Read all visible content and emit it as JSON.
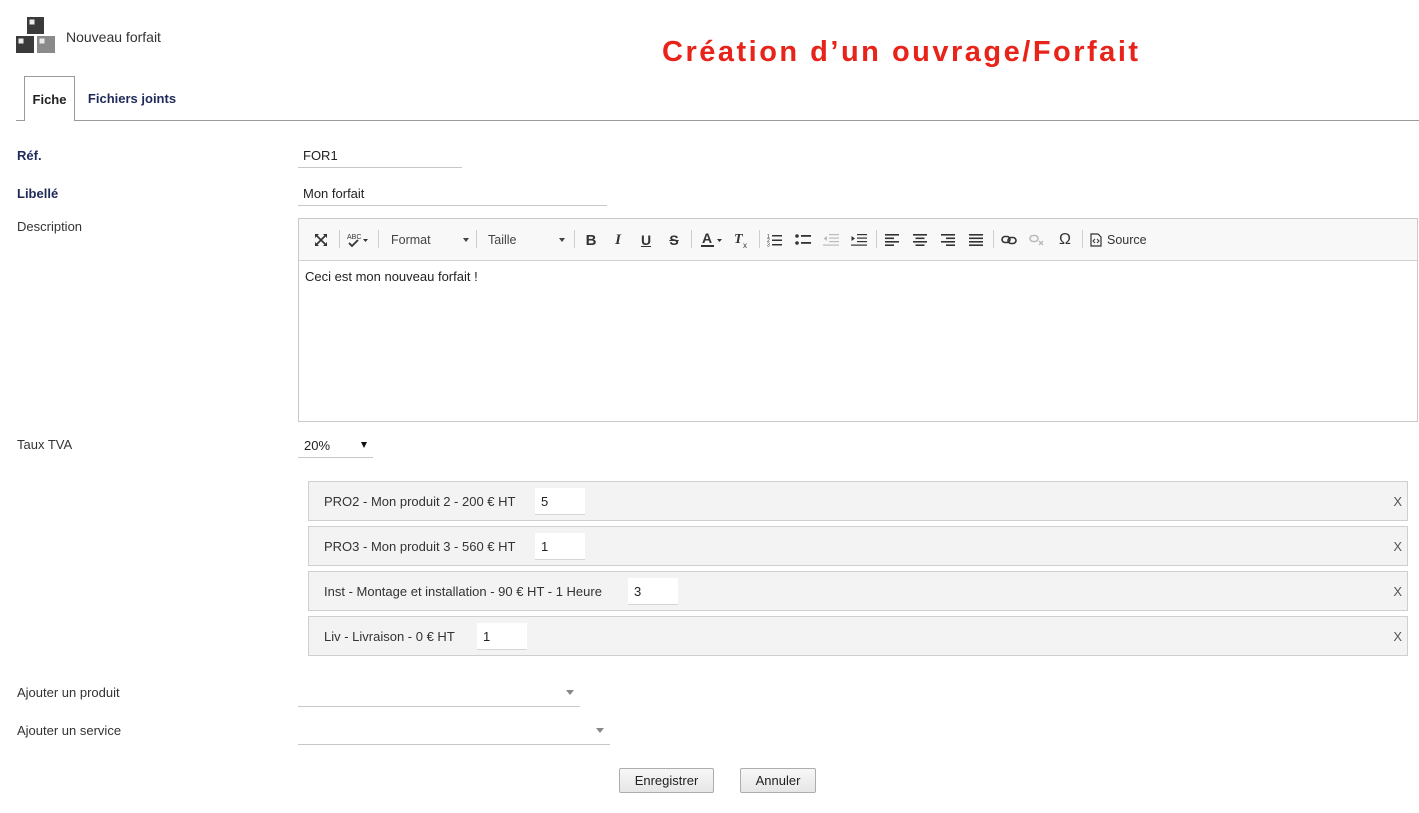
{
  "header": {
    "window_title": "Nouveau forfait",
    "banner": "Création d’un ouvrage/Forfait",
    "banner_color": "#e8231a",
    "logo_icon": "blocks-icon"
  },
  "tabs": [
    {
      "label": "Fiche",
      "active": true
    },
    {
      "label": "Fichiers joints",
      "active": false
    }
  ],
  "form": {
    "ref_label": "Réf.",
    "ref_value": "FOR1",
    "libelle_label": "Libellé",
    "libelle_value": "Mon forfait",
    "description_label": "Description",
    "description_content": "Ceci est mon nouveau forfait !",
    "tva_label": "Taux TVA",
    "tva_value": "20%",
    "add_product_label": "Ajouter un produit",
    "add_service_label": "Ajouter un service"
  },
  "editor_toolbar": {
    "format_label": "Format",
    "size_label": "Taille",
    "source_label": "Source",
    "icons": [
      "maximize-icon",
      "spellcheck-icon",
      "bold-icon",
      "italic-icon",
      "underline-icon",
      "strikethrough-icon",
      "text-color-icon",
      "remove-format-icon",
      "numbered-list-icon",
      "bulleted-list-icon",
      "outdent-icon",
      "indent-icon",
      "align-left-icon",
      "align-center-icon",
      "align-right-icon",
      "justify-icon",
      "link-icon",
      "unlink-icon",
      "special-char-icon",
      "source-icon"
    ]
  },
  "items": [
    {
      "label": "PRO2 - Mon produit 2 - 200 € HT",
      "qty": "5",
      "remove": "X"
    },
    {
      "label": "PRO3 - Mon produit 3 - 560 € HT",
      "qty": "1",
      "remove": "X"
    },
    {
      "label": "Inst - Montage et installation - 90 € HT - 1 Heure",
      "qty": "3",
      "remove": "X"
    },
    {
      "label": "Liv - Livraison - 0 € HT",
      "qty": "1",
      "remove": "X"
    }
  ],
  "buttons": {
    "save": "Enregistrer",
    "cancel": "Annuler"
  }
}
